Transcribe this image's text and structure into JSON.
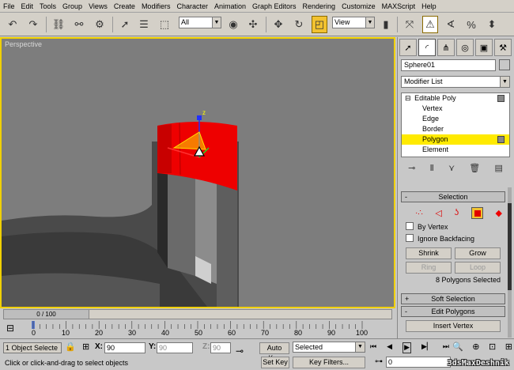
{
  "menu": [
    "File",
    "Edit",
    "Tools",
    "Group",
    "Views",
    "Create",
    "Modifiers",
    "Character",
    "Animation",
    "Graph Editors",
    "Rendering",
    "Customize",
    "MAXScript",
    "Help"
  ],
  "toolbar": {
    "selection_filter": "All",
    "coord_system": "View"
  },
  "viewport": {
    "label": "Perspective",
    "gizmo_label": "z"
  },
  "panel": {
    "object_name": "Sphere01",
    "modifier_list": "Modifier List",
    "stack": {
      "root": "Editable Poly",
      "subobjects": [
        "Vertex",
        "Edge",
        "Border",
        "Polygon",
        "Element"
      ],
      "selected": "Polygon"
    },
    "selection": {
      "title": "Selection",
      "by_vertex": "By Vertex",
      "ignore_backfacing": "Ignore Backfacing",
      "shrink": "Shrink",
      "grow": "Grow",
      "ring": "Ring",
      "loop": "Loop",
      "count": "8 Polygons Selected"
    },
    "soft_selection": "Soft Selection",
    "edit_polygons": "Edit Polygons",
    "insert_vertex": "Insert Vertex"
  },
  "timeline": {
    "frame": "0 / 100",
    "ticks": [
      "0",
      "10",
      "20",
      "30",
      "40",
      "50",
      "60",
      "70",
      "80",
      "90",
      "100"
    ]
  },
  "status": {
    "selection_count": "1 Object Selecte",
    "x_label": "X:",
    "x": "90",
    "y_label": "Y:",
    "y": "90",
    "z_label": "Z:",
    "z": "90",
    "auto_key": "Auto Key",
    "set_key": "Set Key",
    "key_mode": "Selected",
    "key_filters": "Key Filters...",
    "prompt": "Click or click-and-drag to select objects",
    "current_frame": "0"
  },
  "watermark": "3dsMaxDeshnik"
}
